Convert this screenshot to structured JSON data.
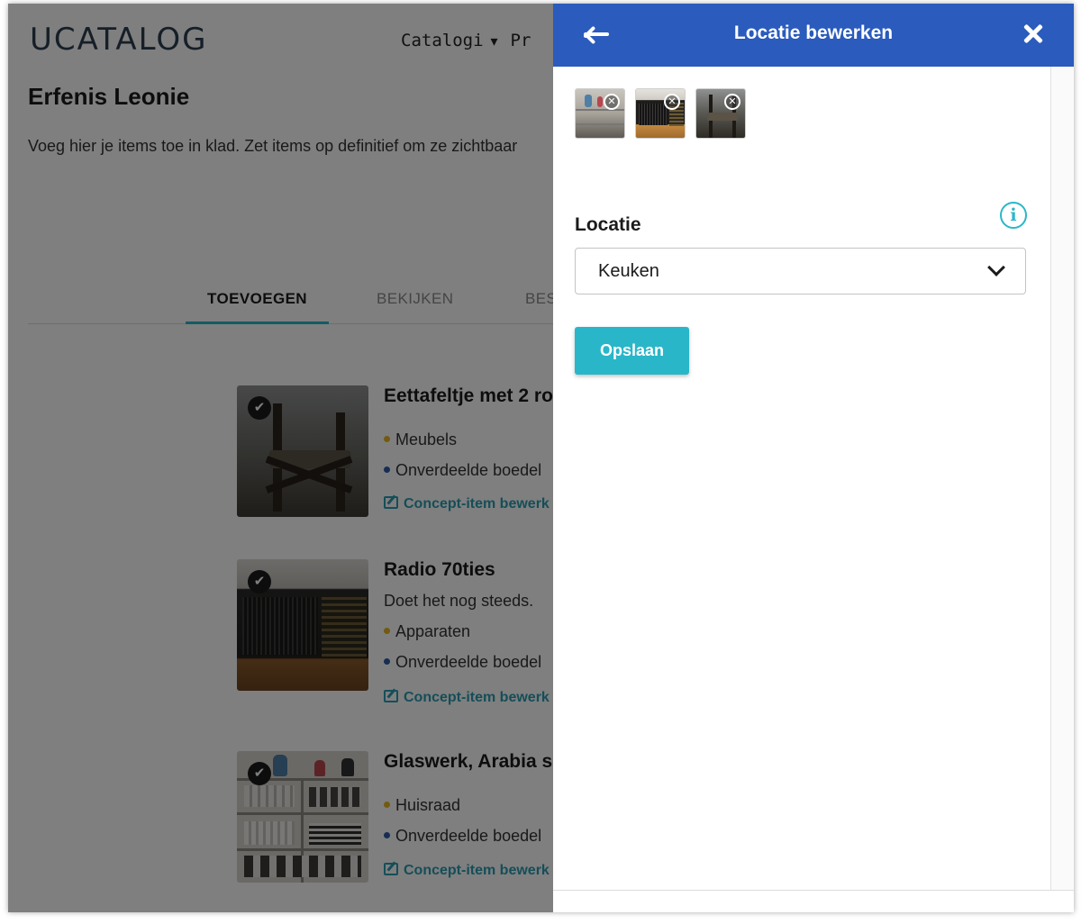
{
  "app": {
    "logo": "UCATALOG",
    "nav": [
      {
        "label": "Catalogi"
      },
      {
        "label": "Pr"
      }
    ],
    "page_title": "Erfenis Leonie",
    "intro": "Voeg hier je items toe in klad. Zet items op definitief om ze zichtbaar",
    "tabs": [
      {
        "label": "TOEVOEGEN",
        "active": true
      },
      {
        "label": "BEKIJKEN",
        "active": false
      },
      {
        "label": "BES",
        "active": false
      }
    ],
    "items": [
      {
        "title": "Eettafeltje met 2 ro",
        "description": "",
        "category": "Meubels",
        "estate": "Onverdeelde boedel",
        "link": "Concept-item bewerk"
      },
      {
        "title": "Radio 70ties",
        "description": "Doet het nog steeds.",
        "category": "Apparaten",
        "estate": "Onverdeelde boedel",
        "link": "Concept-item bewerk"
      },
      {
        "title": "Glaswerk, Arabia se",
        "description": "",
        "category": "Huisraad",
        "estate": "Onverdeelde boedel",
        "link": "Concept-item bewerk"
      }
    ],
    "check_glyph": "✔"
  },
  "drawer": {
    "title": "Locatie bewerken",
    "back_icon": "arrow-left-icon",
    "close_icon": "close-icon",
    "photos": [
      {
        "name": "photo-glassware",
        "remove_glyph": "✕"
      },
      {
        "name": "photo-radio",
        "remove_glyph": "✕"
      },
      {
        "name": "photo-chair",
        "remove_glyph": "✕"
      }
    ],
    "field_label": "Locatie",
    "info_glyph": "i",
    "select_value": "Keuken",
    "save_label": "Opslaan"
  },
  "colors": {
    "header_blue": "#2a5bbd",
    "accent_teal": "#29b6c8",
    "category_dot": "#e6b422",
    "estate_dot": "#2e5aa8"
  }
}
